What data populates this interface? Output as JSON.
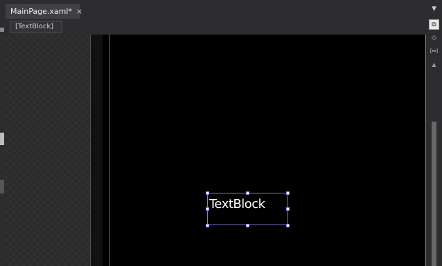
{
  "tabs": [
    {
      "title": "MainPage.xaml*",
      "close_glyph": "×"
    }
  ],
  "tab_overflow_glyph": "▼",
  "breadcrumb": {
    "item": "[TextBlock]"
  },
  "canvas": {
    "element_text": "TextBlock"
  },
  "right_toolbar": {
    "buttons": [
      {
        "icon": "artboard-view-icon",
        "glyph": "⧉"
      },
      {
        "icon": "split-code-icon",
        "glyph": "◇"
      },
      {
        "icon": "expand-width-icon",
        "glyph": "[↔]"
      }
    ],
    "scroll_up_glyph": "▲"
  },
  "colors": {
    "background": "#2d2d30",
    "selection_border": "#7f7fd6",
    "device_screen": "#000000"
  }
}
